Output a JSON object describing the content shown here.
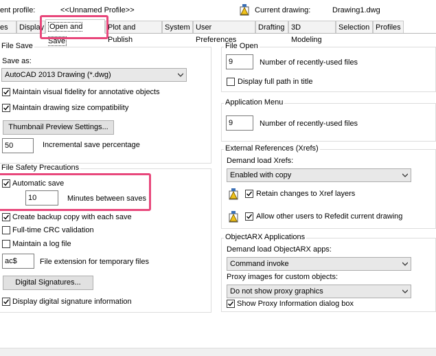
{
  "header": {
    "profile_label": "ent profile:",
    "profile_value": "<<Unnamed Profile>>",
    "current_drawing_label": "Current drawing:",
    "current_drawing_value": "Drawing1.dwg"
  },
  "tabs": [
    {
      "label": "es"
    },
    {
      "label": "Display"
    },
    {
      "label": "Open and Save"
    },
    {
      "label": "Plot and Publish"
    },
    {
      "label": "System"
    },
    {
      "label": "User Preferences"
    },
    {
      "label": "Drafting"
    },
    {
      "label": "3D Modeling"
    },
    {
      "label": "Selection"
    },
    {
      "label": "Profiles"
    }
  ],
  "file_save": {
    "title": "File Save",
    "save_as_label": "Save as:",
    "save_as_value": "AutoCAD 2013 Drawing (*.dwg)",
    "maintain_fidelity": "Maintain visual fidelity for annotative objects",
    "maintain_size": "Maintain drawing size compatibility",
    "thumbnail_button": "Thumbnail Preview Settings...",
    "incremental_value": "50",
    "incremental_label": "Incremental save percentage"
  },
  "file_safety": {
    "title": "File Safety Precautions",
    "automatic_save": "Automatic save",
    "minutes_value": "10",
    "minutes_label": "Minutes between saves",
    "create_backup": "Create backup copy with each save",
    "crc": "Full-time CRC validation",
    "log_file": "Maintain a log file",
    "ext_value": "ac$",
    "ext_label": "File extension for temporary files",
    "digital_sig_button": "Digital Signatures...",
    "display_sig": "Display digital signature information"
  },
  "file_open": {
    "title": "File Open",
    "recent_value": "9",
    "recent_label": "Number of recently-used files",
    "full_path": "Display full path in title"
  },
  "app_menu": {
    "title": "Application Menu",
    "recent_value": "9",
    "recent_label": "Number of recently-used files"
  },
  "xrefs": {
    "title": "External References (Xrefs)",
    "demand_label": "Demand load Xrefs:",
    "demand_value": "Enabled with copy",
    "retain": "Retain changes to Xref layers",
    "allow": "Allow other users to Refedit current drawing"
  },
  "objectarx": {
    "title": "ObjectARX Applications",
    "demand_label": "Demand load ObjectARX apps:",
    "demand_value": "Command invoke",
    "proxy_label": "Proxy images for custom objects:",
    "proxy_value": "Do not show proxy graphics",
    "show_proxy": "Show Proxy Information dialog box"
  },
  "colors": {
    "highlight": "#e8477b",
    "drawing_icon": "#f0c21b"
  }
}
